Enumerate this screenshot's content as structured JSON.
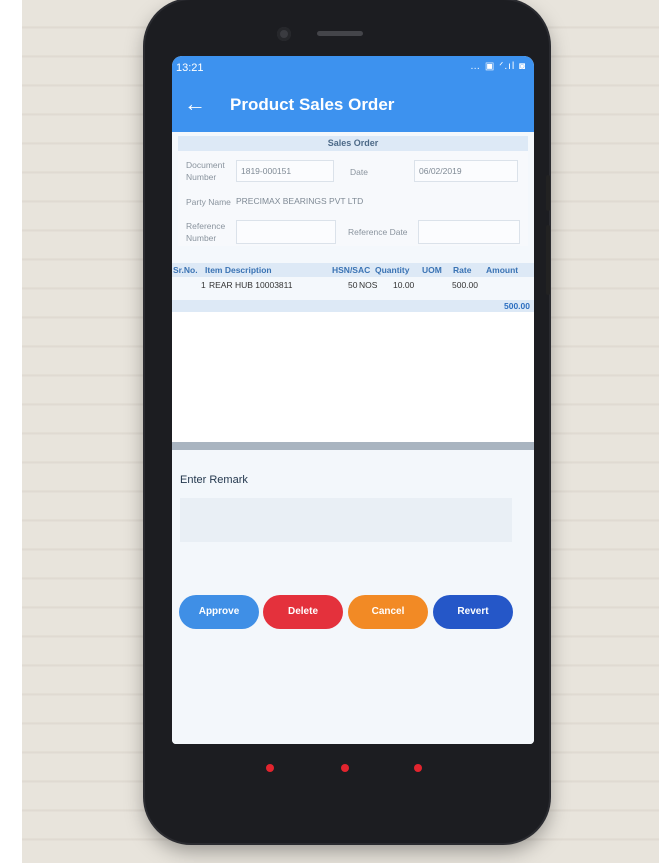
{
  "status_bar": {
    "time": "13:21",
    "icons": "… ▣ ᐟ.ıl ◙"
  },
  "app_bar": {
    "back_icon": "arrow-left",
    "title": "Product Sales Order"
  },
  "form": {
    "section_title": "Sales Order",
    "document_number": {
      "label_line1": "Document",
      "label_line2": "Number",
      "value": "1819-000151"
    },
    "date": {
      "label": "Date",
      "value": "06/02/2019"
    },
    "party_name": {
      "label": "Party Name",
      "value": "PRECIMAX BEARINGS PVT LTD"
    },
    "reference_number": {
      "label_line1": "Reference",
      "label_line2": "Number",
      "value": ""
    },
    "reference_date": {
      "label": "Reference Date",
      "value": ""
    }
  },
  "table": {
    "columns": [
      "Sr.No.",
      "Item Description",
      "HSN/SAC",
      "Quantity",
      "UOM",
      "Rate",
      "Amount"
    ],
    "rows": [
      {
        "sr": "1",
        "item": "REAR HUB 10003811",
        "hsn": "",
        "quantity": "50",
        "uom": "NOS",
        "rate": "10.00",
        "amount": "500.00"
      }
    ],
    "total": "500.00"
  },
  "remark": {
    "label": "Enter Remark",
    "placeholder": ""
  },
  "actions": {
    "approve": "Approve",
    "delete": "Delete",
    "cancel": "Cancel",
    "revert": "Revert"
  },
  "colors": {
    "app_bar": "#3d92ef",
    "approve": "#3f8fe6",
    "delete": "#e4313c",
    "cancel": "#f28a25",
    "revert": "#2557c8"
  }
}
